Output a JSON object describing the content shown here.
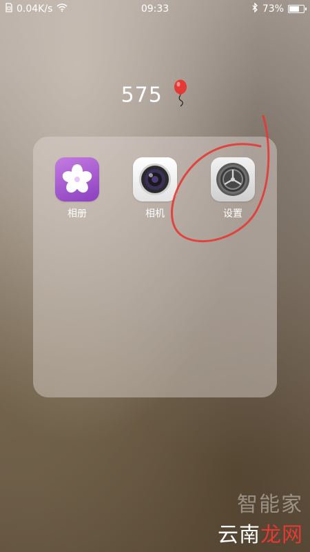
{
  "status_bar": {
    "network_speed": "0.04K/s",
    "time": "09:33",
    "battery_percent": "73%",
    "battery_level": 0.73,
    "icons": [
      "sim-icon",
      "wifi-icon",
      "bluetooth-icon",
      "battery-icon"
    ]
  },
  "folder": {
    "title": "575",
    "title_icon": "balloon-icon",
    "apps": [
      {
        "label": "相册",
        "icon": "photos-flower-icon"
      },
      {
        "label": "相机",
        "icon": "camera-lens-icon"
      },
      {
        "label": "设置",
        "icon": "settings-gear-icon"
      }
    ]
  },
  "annotation": {
    "color": "#e53935",
    "target": "设置"
  },
  "watermark": {
    "line1": "智能家",
    "line2_a": "云南",
    "line2_b": "龙网"
  }
}
